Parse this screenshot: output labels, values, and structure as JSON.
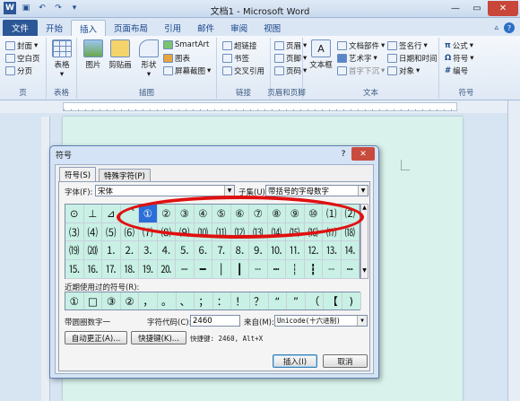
{
  "window": {
    "title": "文档1 - Microsoft Word"
  },
  "ribbon_tabs": [
    "文件",
    "开始",
    "插入",
    "页面布局",
    "引用",
    "邮件",
    "审阅",
    "视图"
  ],
  "ribbon": {
    "pages": {
      "cover": "封面",
      "blank": "空白页",
      "break": "分页",
      "label": "页"
    },
    "table": {
      "btn": "表格",
      "label": "表格"
    },
    "illus": {
      "picture": "图片",
      "clipart": "剪贴画",
      "shapes": "形状",
      "smartart": "SmartArt",
      "chart": "图表",
      "screenshot": "屏幕截图",
      "label": "插图"
    },
    "links": {
      "hyperlink": "超链接",
      "bookmark": "书签",
      "xref": "交叉引用",
      "label": "链接"
    },
    "hf": {
      "header": "页眉",
      "footer": "页脚",
      "pagenum": "页码",
      "label": "页眉和页脚"
    },
    "text": {
      "textbox": "文本框",
      "parts": "文档部件",
      "wordart": "艺术字",
      "dropcap": "首字下沉",
      "sigline": "签名行",
      "datetime": "日期和时间",
      "object": "对象",
      "label": "文本"
    },
    "symbols": {
      "equation": "公式",
      "symbol": "符号",
      "number": "编号",
      "label": "符号"
    }
  },
  "dialog": {
    "title": "符号",
    "tabs": [
      "符号(S)",
      "特殊字符(P)"
    ],
    "font_label": "字体(F):",
    "font_value": "宋体",
    "subset_label": "子集(U):",
    "subset_value": "带括号的字母数字",
    "grid_rows": [
      [
        "⊙",
        "⊥",
        "⊿",
        "⌒",
        "①",
        "②",
        "③",
        "④",
        "⑤",
        "⑥",
        "⑦",
        "⑧",
        "⑨",
        "⑩",
        "⑴",
        "⑵"
      ],
      [
        "⑶",
        "⑷",
        "⑸",
        "⑹",
        "⑺",
        "⑻",
        "⑼",
        "⑽",
        "⑾",
        "⑿",
        "⒀",
        "⒁",
        "⒂",
        "⒃",
        "⒄",
        "⒅"
      ],
      [
        "⒆",
        "⒇",
        "⒈",
        "⒉",
        "⒊",
        "⒋",
        "⒌",
        "⒍",
        "⒎",
        "⒏",
        "⒐",
        "⒑",
        "⒒",
        "⒓",
        "⒔",
        "⒕"
      ],
      [
        "⒖",
        "⒗",
        "⒘",
        "⒙",
        "⒚",
        "⒛",
        "─",
        "━",
        "│",
        "┃",
        "┄",
        "┅",
        "┆",
        "┇",
        "┈",
        "┉"
      ]
    ],
    "selected_symbol": "①",
    "recent_label": "近期使用过的符号(R):",
    "recent": [
      "①",
      "□",
      "③",
      "②",
      "，",
      "。",
      "、",
      "；",
      "：",
      "！",
      "？",
      "“",
      "”",
      "（",
      "【",
      ")"
    ],
    "char_name": "带圆圈数字一",
    "code_label": "字符代码(C):",
    "code_value": "2460",
    "from_label": "来自(M):",
    "from_value": "Unicode(十六进制)",
    "autocorrect_btn": "自动更正(A)...",
    "shortcut_btn": "快捷键(K)...",
    "shortcut_text": "快捷键: 2460, Alt+X",
    "insert_btn": "插入(I)",
    "cancel_btn": "取消"
  }
}
